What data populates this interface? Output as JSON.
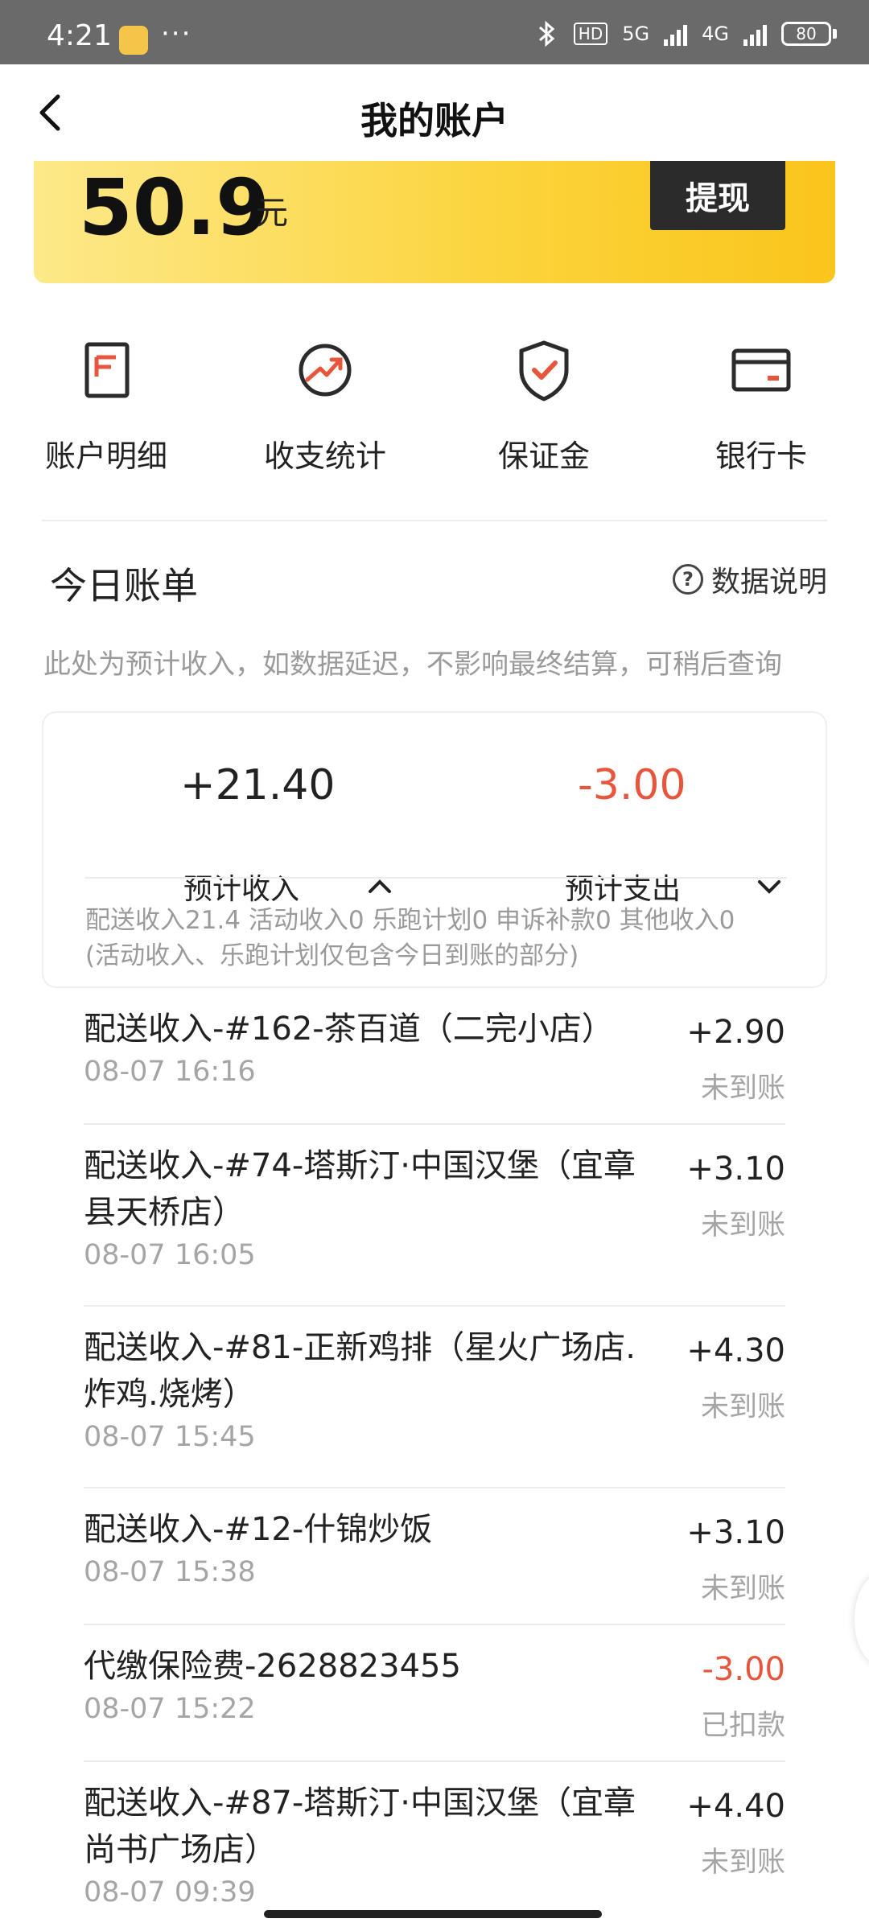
{
  "status_bar": {
    "time": "4:21",
    "more": "···",
    "network_hd": "HD",
    "net_5g": "5G",
    "net_4g": "4G",
    "battery": "80"
  },
  "header": {
    "title": "我的账户"
  },
  "balance": {
    "amount": "50.9",
    "unit": "元",
    "withdraw_label": "提现"
  },
  "actions": [
    {
      "label": "账户明细",
      "icon": "document-icon"
    },
    {
      "label": "收支统计",
      "icon": "trend-chart-icon"
    },
    {
      "label": "保证金",
      "icon": "shield-check-icon"
    },
    {
      "label": "银行卡",
      "icon": "bank-card-icon"
    }
  ],
  "today": {
    "title": "今日账单",
    "data_explain": "数据说明",
    "notice": "此处为预计收入，如数据延迟，不影响最终结算，可稍后查询"
  },
  "summary": {
    "income_value": "+21.40",
    "income_label": "预计收入",
    "expense_value": "-3.00",
    "expense_label": "预计支出",
    "detail_line1": "配送收入21.4 活动收入0 乐跑计划0 申诉补款0 其他收入0",
    "detail_line2": "(活动收入、乐跑计划仅包含今日到账的部分)"
  },
  "transactions": [
    {
      "name": "配送收入-#162-茶百道（二完小店）",
      "time": "08-07 16:16",
      "amount": "+2.90",
      "status": "未到账"
    },
    {
      "name": "配送收入-#74-塔斯汀·中国汉堡（宜章县天桥店）",
      "time": "08-07 16:05",
      "amount": "+3.10",
      "status": "未到账"
    },
    {
      "name": "配送收入-#81-正新鸡排（星火广场店.炸鸡.烧烤）",
      "time": "08-07 15:45",
      "amount": "+4.30",
      "status": "未到账"
    },
    {
      "name": "配送收入-#12-什锦炒饭",
      "time": "08-07 15:38",
      "amount": "+3.10",
      "status": "未到账"
    },
    {
      "name": "代缴保险费-2628823455",
      "time": "08-07 15:22",
      "amount": "-3.00",
      "status": "已扣款"
    },
    {
      "name": "配送收入-#87-塔斯汀·中国汉堡（宜章尚书广场店）",
      "time": "08-07 09:39",
      "amount": "+4.40",
      "status": "未到账"
    }
  ],
  "colors": {
    "accent_yellow": "#fbd33a",
    "negative": "#e8553d",
    "icon_red": "#e8553d"
  }
}
